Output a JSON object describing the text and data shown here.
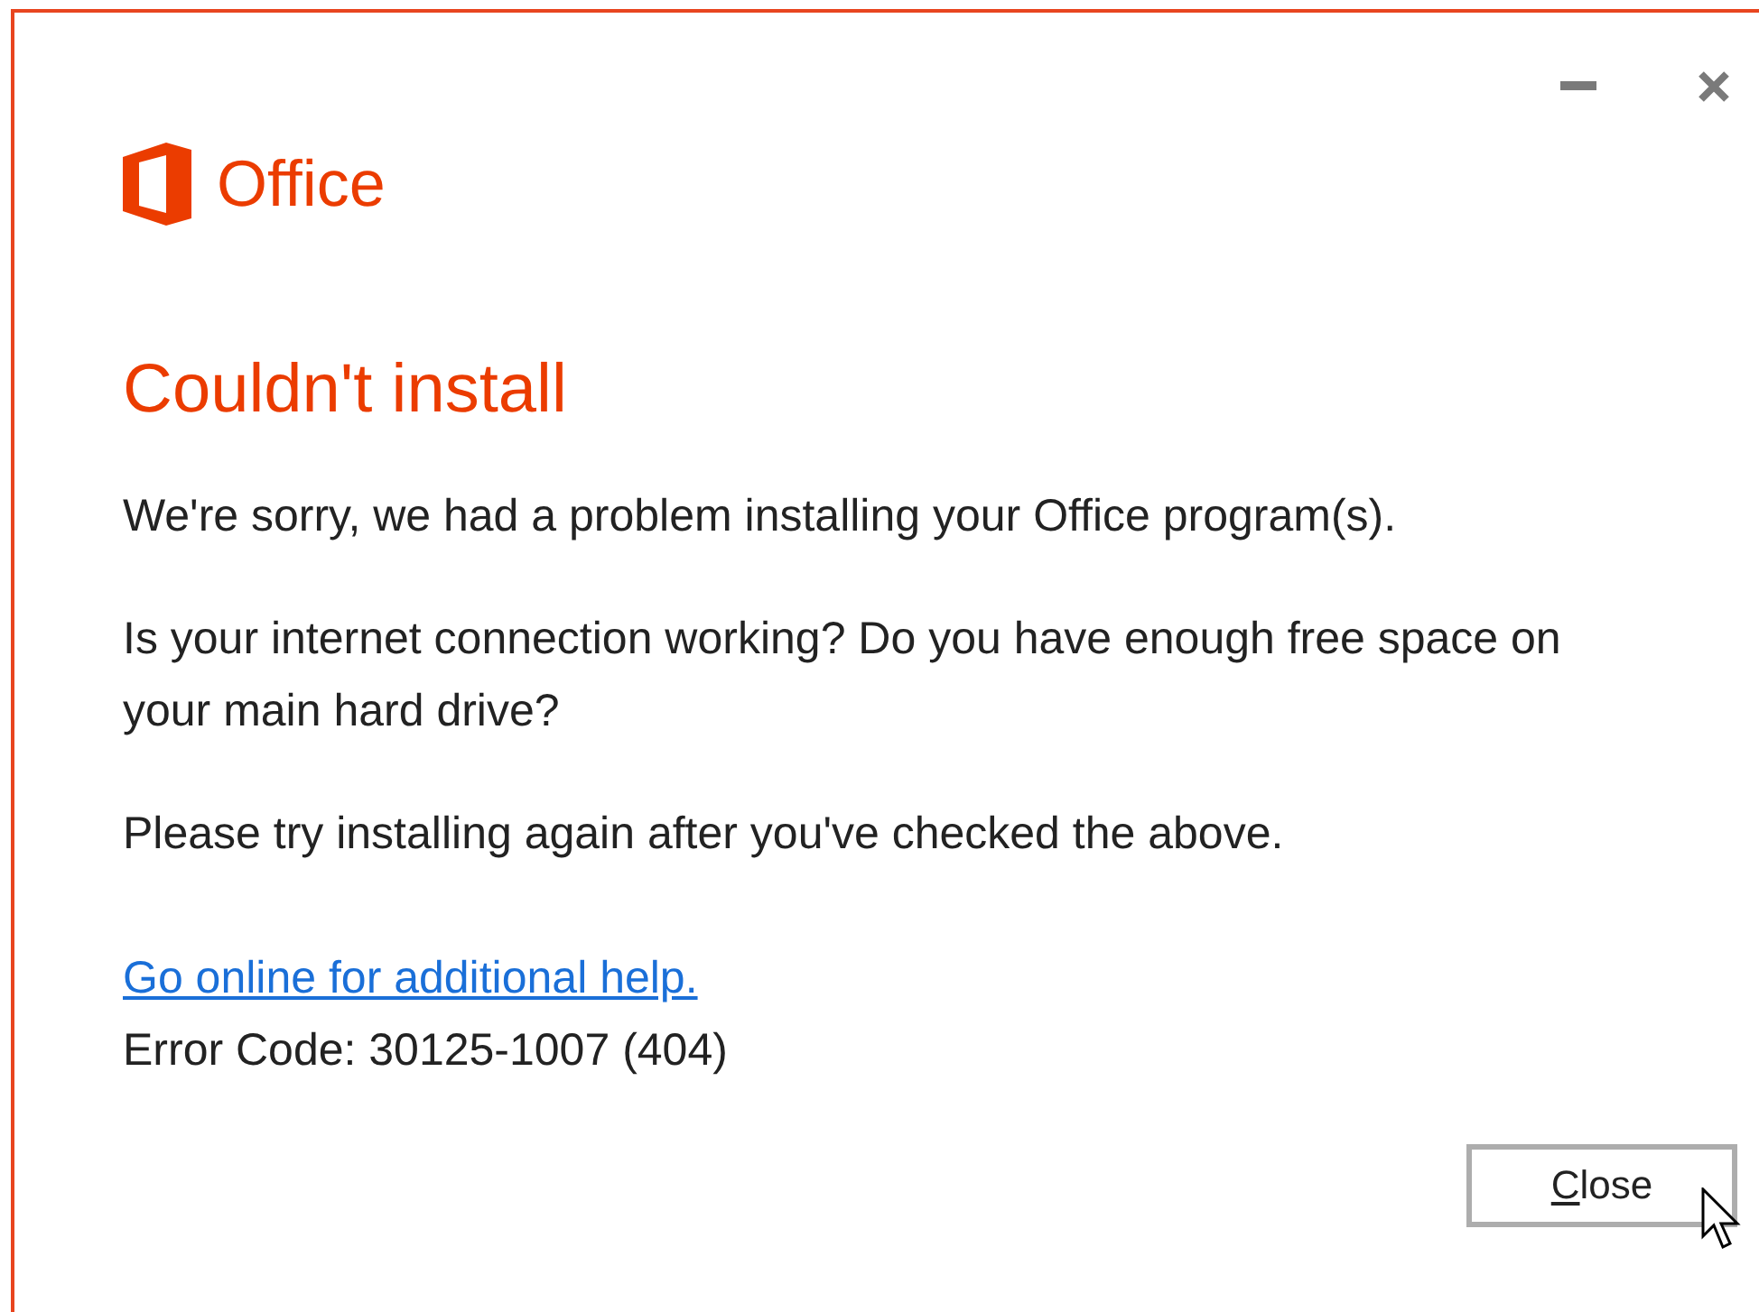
{
  "window": {
    "controls": [
      {
        "kind": "minimize"
      },
      {
        "kind": "close"
      }
    ]
  },
  "logo": {
    "text": "Office"
  },
  "title": "Couldn't install",
  "paragraphs": [
    "We're sorry, we had a problem installing your Office program(s).",
    "Is your internet connection working?  Do you have enough free space on your main hard drive?",
    "Please try installing again after you've checked the above."
  ],
  "help_link": "Go online for additional help.",
  "error_code": "Error Code: 30125-1007 (404)",
  "button": {
    "label_parts": [
      {
        "text": "C",
        "underlined": true
      },
      {
        "text": "lose",
        "underlined": false
      }
    ]
  }
}
